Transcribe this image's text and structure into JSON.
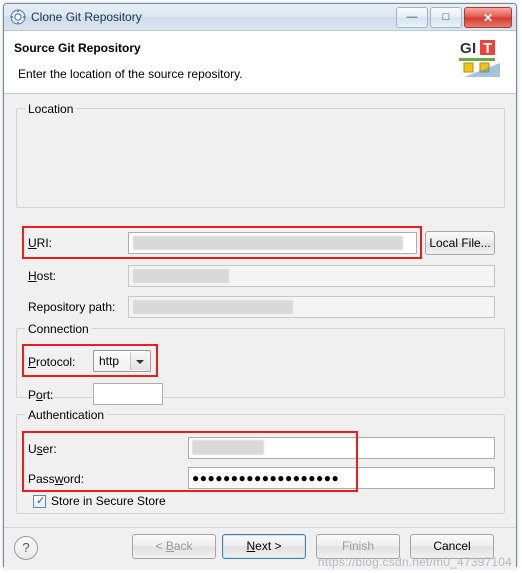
{
  "window": {
    "title": "Clone Git Repository",
    "icon": "git-repo-icon",
    "buttons": {
      "minimize": "minimize-button",
      "maximize": "maximize-button",
      "close": "close-button",
      "minimize_glyph": "—",
      "maximize_glyph": "□",
      "close_glyph": "✕"
    }
  },
  "header": {
    "title": "Source Git Repository",
    "subtitle": "Enter the location of the source repository.",
    "logo_text": "GIT"
  },
  "groups": {
    "location": "Location",
    "connection": "Connection",
    "authentication": "Authentication"
  },
  "fields": {
    "uri": {
      "label": "URI:",
      "value": "",
      "highlight": true
    },
    "host": {
      "label": "Host:",
      "value": ""
    },
    "repository_path": {
      "label": "Repository path:",
      "value": ""
    },
    "protocol": {
      "label": "Protocol:",
      "value": "http",
      "highlight": true
    },
    "port": {
      "label": "Port:",
      "value": ""
    },
    "user": {
      "label": "User:",
      "value": "",
      "highlight": true
    },
    "password": {
      "label": "Password:",
      "value": "●●●●●●●●●●●●●●●●●●●",
      "highlight": true
    }
  },
  "checkbox": {
    "label": "Store in Secure Store",
    "checked": true
  },
  "buttons": {
    "local_file": "Local File...",
    "help": "?",
    "back": "< Back",
    "next": "Next >",
    "finish": "Finish",
    "cancel": "Cancel"
  },
  "watermark": "https://blog.csdn.net/m0_47397104",
  "colors": {
    "highlight": "#ee1c1c",
    "title_text": "#17334e",
    "git_orange": "#f05133"
  }
}
